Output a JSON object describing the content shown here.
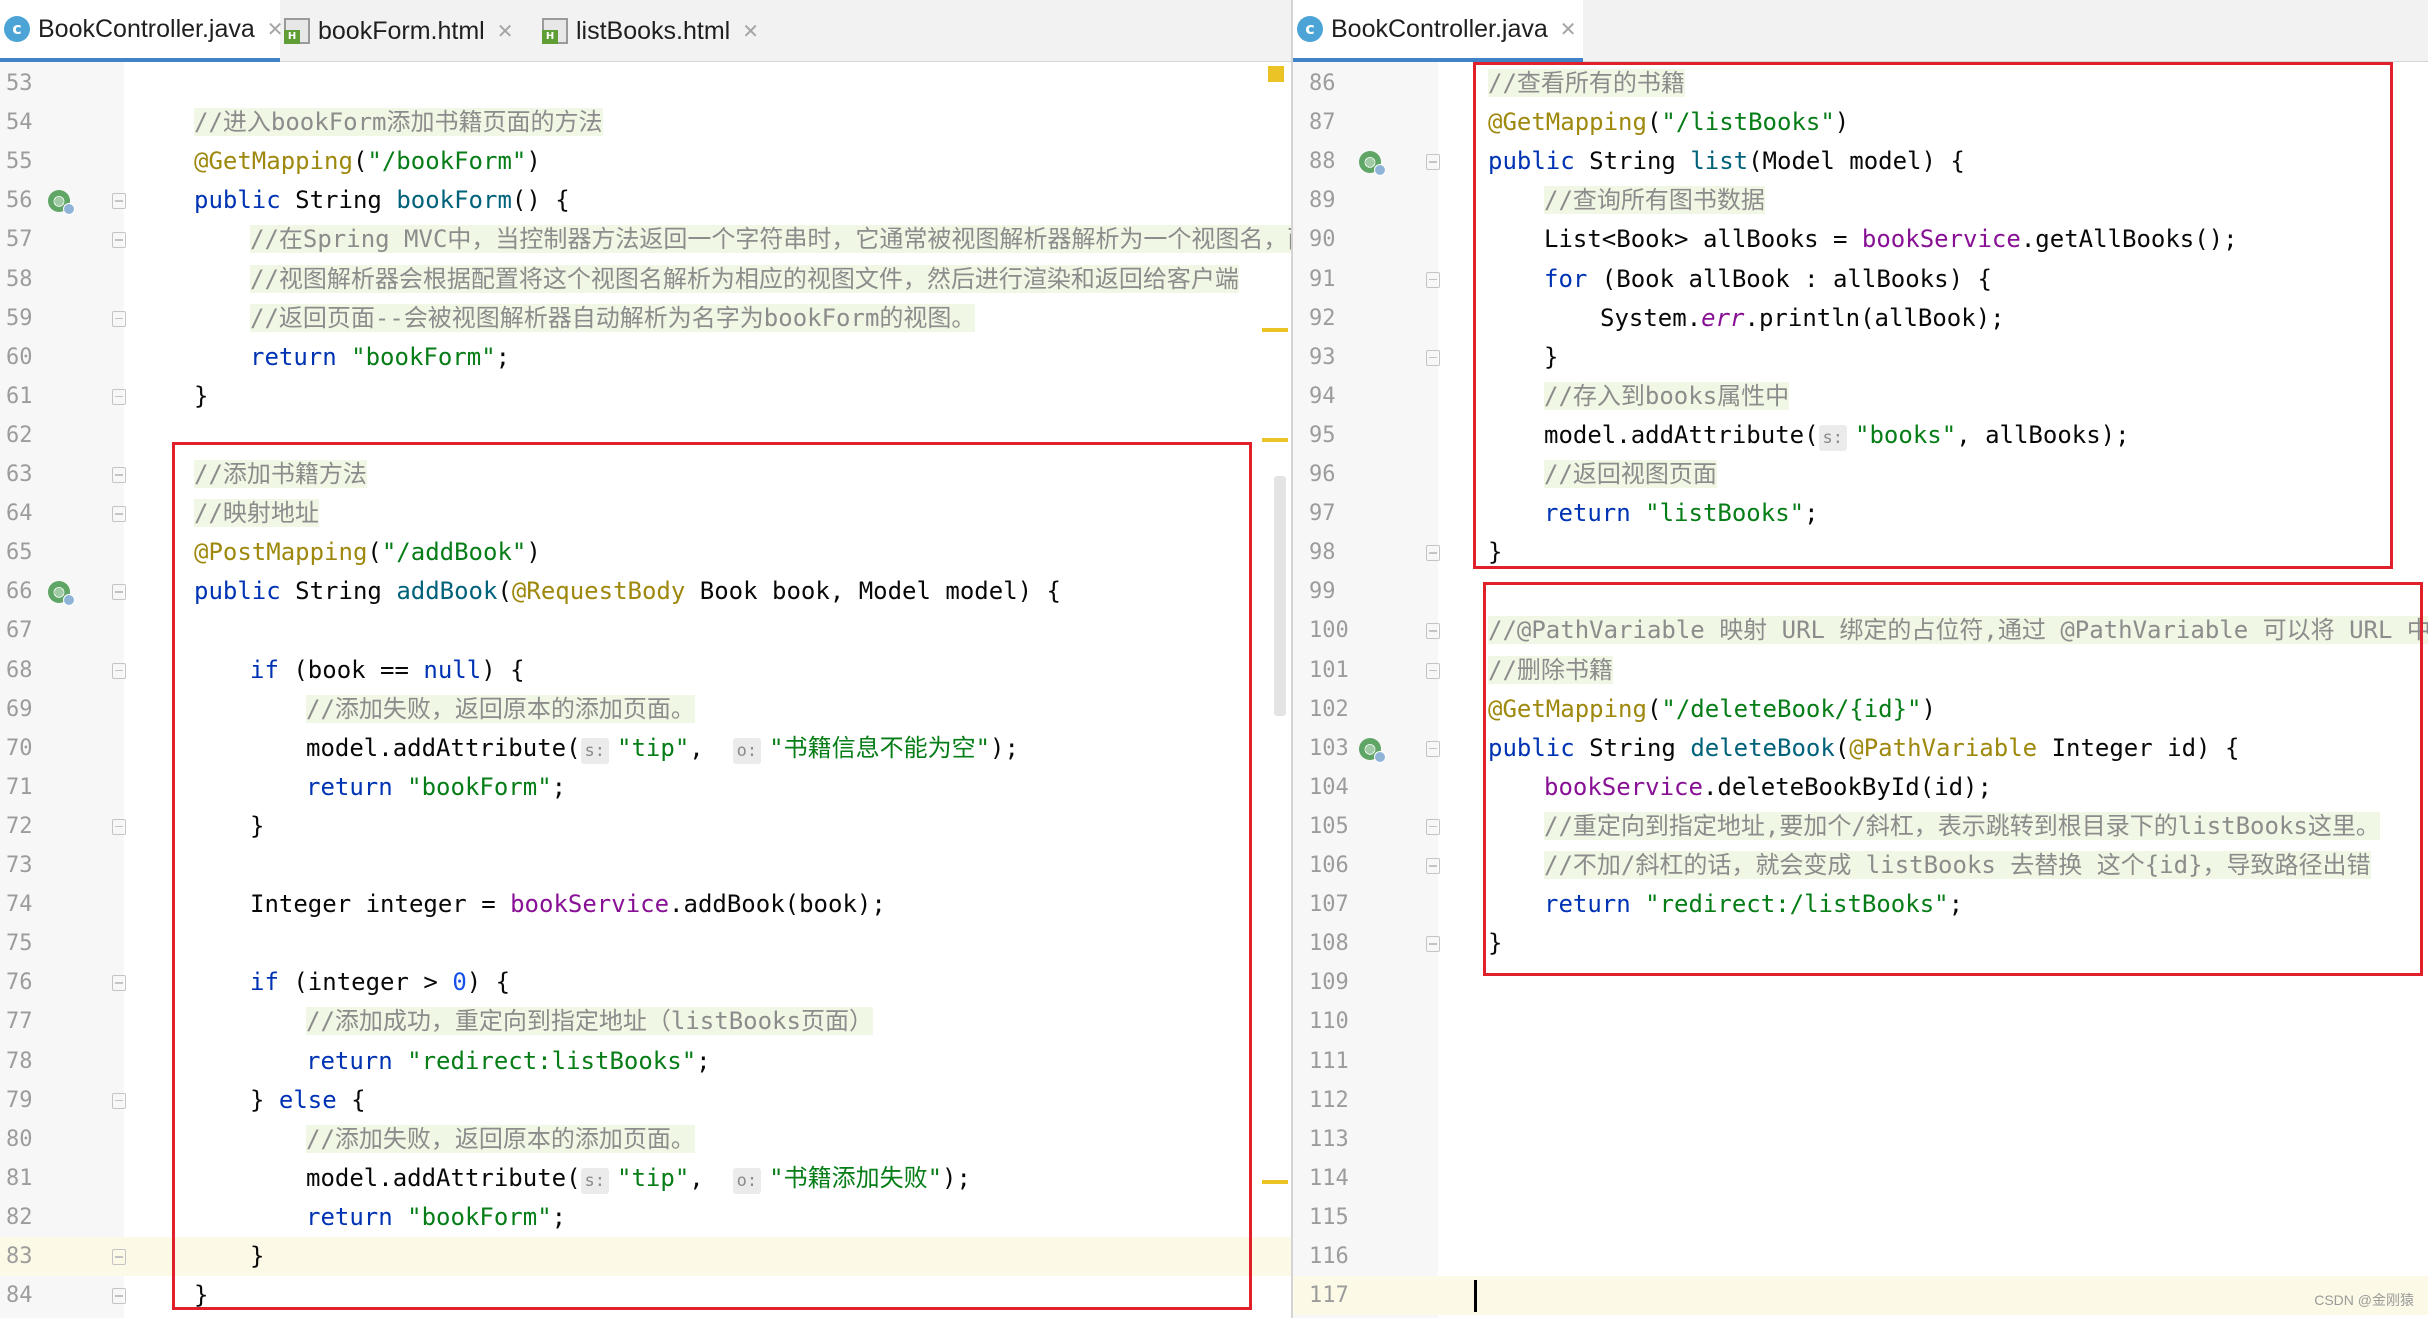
{
  "left_pane": {
    "tabs": [
      {
        "label": "BookController.java",
        "icon": "java-class-icon",
        "active": true
      },
      {
        "label": "bookForm.html",
        "icon": "html-file-icon",
        "active": false
      },
      {
        "label": "listBooks.html",
        "icon": "html-file-icon",
        "active": false
      }
    ],
    "lines": [
      {
        "n": "53",
        "tokens": []
      },
      {
        "n": "54",
        "indent": 1,
        "tokens": [
          {
            "t": "//进入bookForm添加书籍页面的方法",
            "c": "cm"
          }
        ]
      },
      {
        "n": "55",
        "indent": 1,
        "tokens": [
          {
            "t": "@GetMapping",
            "c": "ann"
          },
          {
            "t": "(",
            "c": ""
          },
          {
            "t": "\"/bookForm\"",
            "c": "str"
          },
          {
            "t": ")",
            "c": ""
          }
        ]
      },
      {
        "n": "56",
        "indent": 1,
        "gutter_icon": "bean",
        "fold": true,
        "tokens": [
          {
            "t": "public ",
            "c": "kw"
          },
          {
            "t": "String ",
            "c": ""
          },
          {
            "t": "bookForm",
            "c": "fn"
          },
          {
            "t": "() {",
            "c": ""
          }
        ]
      },
      {
        "n": "57",
        "indent": 2,
        "fold": true,
        "tokens": [
          {
            "t": "//在Spring MVC中，当控制器方法返回一个字符串时，它通常被视图解析器解析为一个视图名，而",
            "c": "cm"
          }
        ]
      },
      {
        "n": "58",
        "indent": 2,
        "tokens": [
          {
            "t": "//视图解析器会根据配置将这个视图名解析为相应的视图文件，然后进行渲染和返回给客户端",
            "c": "cm"
          }
        ]
      },
      {
        "n": "59",
        "indent": 2,
        "fold": true,
        "tokens": [
          {
            "t": "//返回页面--会被视图解析器自动解析为名字为bookForm的视图。",
            "c": "cm"
          }
        ]
      },
      {
        "n": "60",
        "indent": 2,
        "tokens": [
          {
            "t": "return ",
            "c": "kw"
          },
          {
            "t": "\"bookForm\"",
            "c": "str"
          },
          {
            "t": ";",
            "c": ""
          }
        ]
      },
      {
        "n": "61",
        "indent": 1,
        "fold": true,
        "tokens": [
          {
            "t": "}",
            "c": ""
          }
        ]
      },
      {
        "n": "62",
        "tokens": []
      },
      {
        "n": "63",
        "indent": 1,
        "fold": true,
        "tokens": [
          {
            "t": "//添加书籍方法",
            "c": "cm"
          }
        ]
      },
      {
        "n": "64",
        "indent": 1,
        "fold": true,
        "tokens": [
          {
            "t": "//映射地址",
            "c": "cm"
          }
        ]
      },
      {
        "n": "65",
        "indent": 1,
        "tokens": [
          {
            "t": "@PostMapping",
            "c": "ann"
          },
          {
            "t": "(",
            "c": ""
          },
          {
            "t": "\"/addBook\"",
            "c": "str"
          },
          {
            "t": ")",
            "c": ""
          }
        ]
      },
      {
        "n": "66",
        "indent": 1,
        "gutter_icon": "bean",
        "fold": true,
        "tokens": [
          {
            "t": "public ",
            "c": "kw"
          },
          {
            "t": "String ",
            "c": ""
          },
          {
            "t": "addBook",
            "c": "fn"
          },
          {
            "t": "(",
            "c": ""
          },
          {
            "t": "@RequestBody ",
            "c": "ann"
          },
          {
            "t": "Book book, Model model) {",
            "c": ""
          }
        ]
      },
      {
        "n": "67",
        "tokens": []
      },
      {
        "n": "68",
        "indent": 2,
        "fold": true,
        "tokens": [
          {
            "t": "if ",
            "c": "kw"
          },
          {
            "t": "(book == ",
            "c": ""
          },
          {
            "t": "null",
            "c": "kw"
          },
          {
            "t": ") {",
            "c": ""
          }
        ]
      },
      {
        "n": "69",
        "indent": 3,
        "tokens": [
          {
            "t": "//添加失败，返回原本的添加页面。",
            "c": "cm"
          }
        ]
      },
      {
        "n": "70",
        "indent": 3,
        "tokens": [
          {
            "t": "model.addAttribute(",
            "c": ""
          },
          {
            "t": "s:",
            "c": "hint"
          },
          {
            "t": "\"tip\"",
            "c": "str"
          },
          {
            "t": ",  ",
            "c": ""
          },
          {
            "t": "o:",
            "c": "hint"
          },
          {
            "t": "\"书籍信息不能为空\"",
            "c": "str"
          },
          {
            "t": ");",
            "c": ""
          }
        ]
      },
      {
        "n": "71",
        "indent": 3,
        "tokens": [
          {
            "t": "return ",
            "c": "kw"
          },
          {
            "t": "\"bookForm\"",
            "c": "str"
          },
          {
            "t": ";",
            "c": ""
          }
        ]
      },
      {
        "n": "72",
        "indent": 2,
        "fold": true,
        "tokens": [
          {
            "t": "}",
            "c": ""
          }
        ]
      },
      {
        "n": "73",
        "tokens": []
      },
      {
        "n": "74",
        "indent": 2,
        "tokens": [
          {
            "t": "Integer integer = ",
            "c": ""
          },
          {
            "t": "bookService",
            "c": "fld"
          },
          {
            "t": ".addBook(book);",
            "c": ""
          }
        ]
      },
      {
        "n": "75",
        "tokens": []
      },
      {
        "n": "76",
        "indent": 2,
        "fold": true,
        "tokens": [
          {
            "t": "if ",
            "c": "kw"
          },
          {
            "t": "(integer > ",
            "c": ""
          },
          {
            "t": "0",
            "c": "num"
          },
          {
            "t": ") {",
            "c": ""
          }
        ]
      },
      {
        "n": "77",
        "indent": 3,
        "tokens": [
          {
            "t": "//添加成功，重定向到指定地址（listBooks页面）",
            "c": "cm"
          }
        ]
      },
      {
        "n": "78",
        "indent": 3,
        "tokens": [
          {
            "t": "return ",
            "c": "kw"
          },
          {
            "t": "\"redirect:listBooks\"",
            "c": "str"
          },
          {
            "t": ";",
            "c": ""
          }
        ]
      },
      {
        "n": "79",
        "indent": 2,
        "fold": true,
        "tokens": [
          {
            "t": "} ",
            "c": ""
          },
          {
            "t": "else ",
            "c": "kw"
          },
          {
            "t": "{",
            "c": ""
          }
        ]
      },
      {
        "n": "80",
        "indent": 3,
        "tokens": [
          {
            "t": "//添加失败，返回原本的添加页面。",
            "c": "cm"
          }
        ]
      },
      {
        "n": "81",
        "indent": 3,
        "tokens": [
          {
            "t": "model.addAttribute(",
            "c": ""
          },
          {
            "t": "s:",
            "c": "hint"
          },
          {
            "t": "\"tip\"",
            "c": "str"
          },
          {
            "t": ",  ",
            "c": ""
          },
          {
            "t": "o:",
            "c": "hint"
          },
          {
            "t": "\"书籍添加失败\"",
            "c": "str"
          },
          {
            "t": ");",
            "c": ""
          }
        ]
      },
      {
        "n": "82",
        "indent": 3,
        "tokens": [
          {
            "t": "return ",
            "c": "kw"
          },
          {
            "t": "\"bookForm\"",
            "c": "str"
          },
          {
            "t": ";",
            "c": ""
          }
        ]
      },
      {
        "n": "83",
        "indent": 2,
        "fold": true,
        "current": true,
        "tokens": [
          {
            "t": "}",
            "c": ""
          }
        ]
      },
      {
        "n": "84",
        "indent": 1,
        "fold": true,
        "tokens": [
          {
            "t": "}",
            "c": ""
          }
        ]
      }
    ]
  },
  "right_pane": {
    "tabs": [
      {
        "label": "BookController.java",
        "icon": "java-class-icon",
        "active": true
      }
    ],
    "lines": [
      {
        "n": "86",
        "indent": 1,
        "tokens": [
          {
            "t": "//查看所有的书籍",
            "c": "cm"
          }
        ]
      },
      {
        "n": "87",
        "indent": 1,
        "tokens": [
          {
            "t": "@GetMapping",
            "c": "ann"
          },
          {
            "t": "(",
            "c": ""
          },
          {
            "t": "\"/listBooks\"",
            "c": "str"
          },
          {
            "t": ")",
            "c": ""
          }
        ]
      },
      {
        "n": "88",
        "indent": 1,
        "gutter_icon": "bean",
        "fold": true,
        "tokens": [
          {
            "t": "public ",
            "c": "kw"
          },
          {
            "t": "String ",
            "c": ""
          },
          {
            "t": "list",
            "c": "fn"
          },
          {
            "t": "(Model model) {",
            "c": ""
          }
        ]
      },
      {
        "n": "89",
        "indent": 2,
        "tokens": [
          {
            "t": "//查询所有图书数据",
            "c": "cm"
          }
        ]
      },
      {
        "n": "90",
        "indent": 2,
        "tokens": [
          {
            "t": "List<Book> allBooks = ",
            "c": ""
          },
          {
            "t": "bookService",
            "c": "fld"
          },
          {
            "t": ".getAllBooks();",
            "c": ""
          }
        ]
      },
      {
        "n": "91",
        "indent": 2,
        "fold": true,
        "tokens": [
          {
            "t": "for ",
            "c": "kw"
          },
          {
            "t": "(Book allBook : allBooks) {",
            "c": ""
          }
        ]
      },
      {
        "n": "92",
        "indent": 3,
        "tokens": [
          {
            "t": "System.",
            "c": ""
          },
          {
            "t": "err",
            "c": "ital"
          },
          {
            "t": ".println(allBook);",
            "c": ""
          }
        ]
      },
      {
        "n": "93",
        "indent": 2,
        "fold": true,
        "tokens": [
          {
            "t": "}",
            "c": ""
          }
        ]
      },
      {
        "n": "94",
        "indent": 2,
        "tokens": [
          {
            "t": "//存入到books属性中",
            "c": "cm"
          }
        ]
      },
      {
        "n": "95",
        "indent": 2,
        "tokens": [
          {
            "t": "model.addAttribute(",
            "c": ""
          },
          {
            "t": "s:",
            "c": "hint"
          },
          {
            "t": "\"books\"",
            "c": "str"
          },
          {
            "t": ", allBooks);",
            "c": ""
          }
        ]
      },
      {
        "n": "96",
        "indent": 2,
        "tokens": [
          {
            "t": "//返回视图页面",
            "c": "cm"
          }
        ]
      },
      {
        "n": "97",
        "indent": 2,
        "tokens": [
          {
            "t": "return ",
            "c": "kw"
          },
          {
            "t": "\"listBooks\"",
            "c": "str"
          },
          {
            "t": ";",
            "c": ""
          }
        ]
      },
      {
        "n": "98",
        "indent": 1,
        "fold": true,
        "tokens": [
          {
            "t": "}",
            "c": ""
          }
        ]
      },
      {
        "n": "99",
        "tokens": []
      },
      {
        "n": "100",
        "indent": 1,
        "fold": true,
        "tokens": [
          {
            "t": "//@PathVariable 映射 URL 绑定的占位符,通过 @PathVariable 可以将 URL 中",
            "c": "cm"
          }
        ]
      },
      {
        "n": "101",
        "indent": 1,
        "fold": true,
        "tokens": [
          {
            "t": "//删除书籍",
            "c": "cm"
          }
        ]
      },
      {
        "n": "102",
        "indent": 1,
        "tokens": [
          {
            "t": "@GetMapping",
            "c": "ann"
          },
          {
            "t": "(",
            "c": ""
          },
          {
            "t": "\"/deleteBook/{id}\"",
            "c": "str"
          },
          {
            "t": ")",
            "c": ""
          }
        ]
      },
      {
        "n": "103",
        "indent": 1,
        "gutter_icon": "bean",
        "fold": true,
        "tokens": [
          {
            "t": "public ",
            "c": "kw"
          },
          {
            "t": "String ",
            "c": ""
          },
          {
            "t": "deleteBook",
            "c": "fn"
          },
          {
            "t": "(",
            "c": ""
          },
          {
            "t": "@PathVariable ",
            "c": "ann"
          },
          {
            "t": "Integer id) {",
            "c": ""
          }
        ]
      },
      {
        "n": "104",
        "indent": 2,
        "tokens": [
          {
            "t": "bookService",
            "c": "fld"
          },
          {
            "t": ".deleteBookById(id);",
            "c": ""
          }
        ]
      },
      {
        "n": "105",
        "indent": 2,
        "fold": true,
        "tokens": [
          {
            "t": "//重定向到指定地址,要加个/斜杠，表示跳转到根目录下的listBooks这里。",
            "c": "cm"
          }
        ]
      },
      {
        "n": "106",
        "indent": 2,
        "fold": true,
        "tokens": [
          {
            "t": "//不加/斜杠的话，就会变成 listBooks 去替换 这个{id}，导致路径出错",
            "c": "cm"
          }
        ]
      },
      {
        "n": "107",
        "indent": 2,
        "tokens": [
          {
            "t": "return ",
            "c": "kw"
          },
          {
            "t": "\"redirect:/listBooks\"",
            "c": "str"
          },
          {
            "t": ";",
            "c": ""
          }
        ]
      },
      {
        "n": "108",
        "indent": 1,
        "fold": true,
        "tokens": [
          {
            "t": "}",
            "c": ""
          }
        ]
      },
      {
        "n": "109",
        "tokens": []
      },
      {
        "n": "110",
        "tokens": []
      },
      {
        "n": "111",
        "tokens": []
      },
      {
        "n": "112",
        "tokens": []
      },
      {
        "n": "113",
        "tokens": []
      },
      {
        "n": "114",
        "tokens": []
      },
      {
        "n": "115",
        "tokens": []
      },
      {
        "n": "116",
        "tokens": []
      },
      {
        "n": "117",
        "current": true,
        "caret": true,
        "tokens": []
      }
    ]
  },
  "watermark": "CSDN @金刚猿",
  "colors": {
    "highlight_box": "#e0202a",
    "keyword": "#0033b3",
    "annotation": "#9e880d",
    "string": "#067d17",
    "comment": "#8c8c8c",
    "field": "#871094",
    "method": "#00627a",
    "warning_marker": "#ecc324"
  }
}
